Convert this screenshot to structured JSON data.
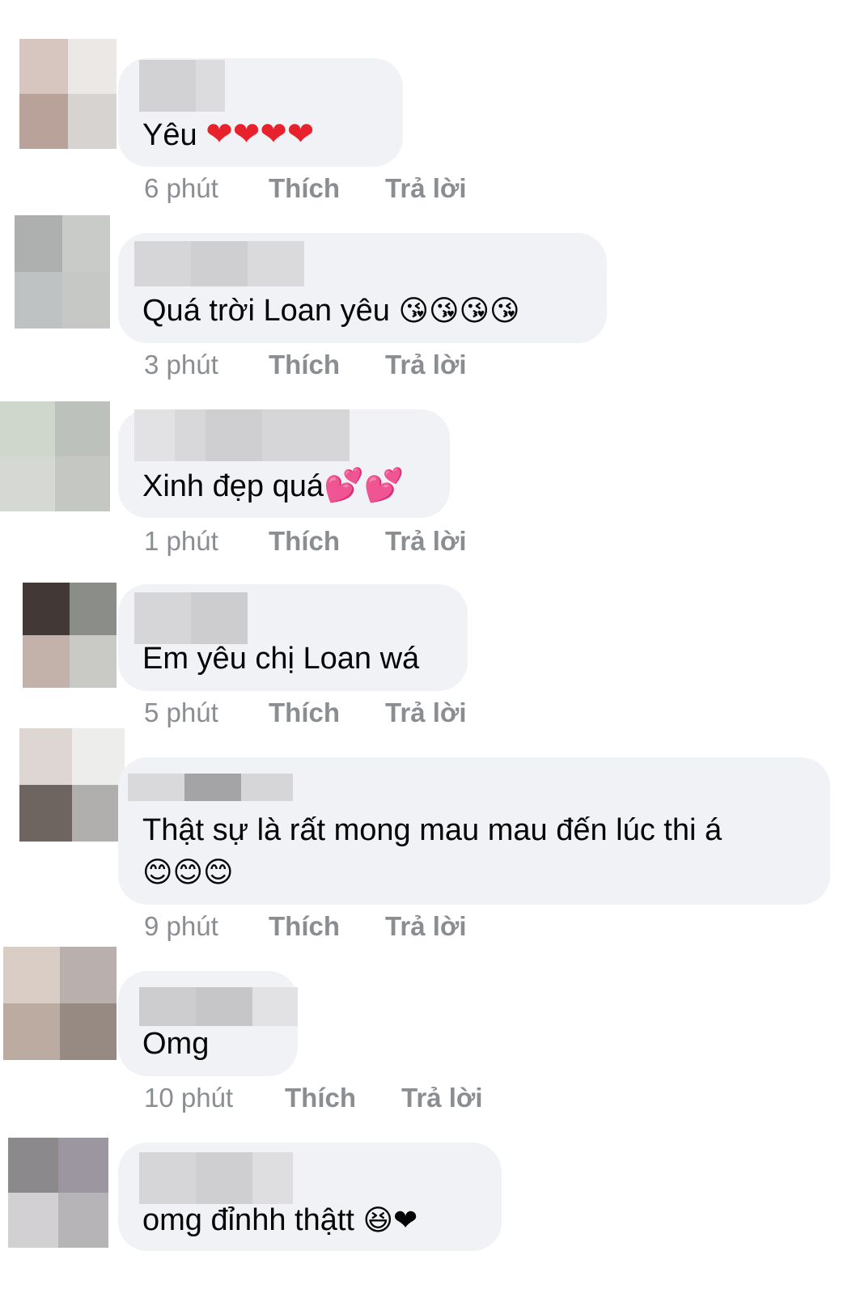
{
  "comments": [
    {
      "text": "Yêu",
      "emoji": "❤❤❤❤",
      "time": "6 phút",
      "like": "Thích",
      "reply": "Trả lời"
    },
    {
      "text": "Quá trời Loan yêu",
      "emoji": "😘😘😘😘",
      "time": "3 phút",
      "like": "Thích",
      "reply": "Trả lời"
    },
    {
      "text": "Xinh đẹp quá",
      "emoji": "💕💕",
      "time": "1 phút",
      "like": "Thích",
      "reply": "Trả lời"
    },
    {
      "text": "Em yêu chị Loan wá",
      "emoji": "",
      "time": "5 phút",
      "like": "Thích",
      "reply": "Trả lời"
    },
    {
      "text": "Thật sự là rất mong mau mau đến lúc thi á",
      "emoji": "😊😊😊",
      "time": "9 phút",
      "like": "Thích",
      "reply": "Trả lời"
    },
    {
      "text": "Omg",
      "emoji": "",
      "time": "10 phút",
      "like": "Thích",
      "reply": "Trả lời"
    },
    {
      "text": "omg đỉnhh thậtt",
      "emoji": "😆❤",
      "time": "",
      "like": "",
      "reply": ""
    }
  ],
  "colors": {
    "bubble": "#f0f2f5",
    "meta_text": "#8a8d91",
    "heart": "#e8222c"
  }
}
